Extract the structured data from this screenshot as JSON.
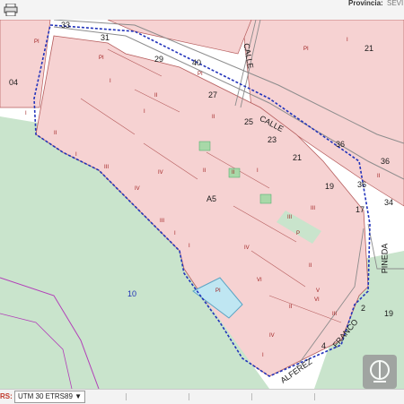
{
  "toolbar": {
    "province_label": "Provincia:",
    "province_value": "SEVI"
  },
  "map": {
    "street_labels": [
      "CALLE",
      "CALLE",
      "PINEDA",
      "FRANCO",
      "ALFEREZ"
    ],
    "house_numbers": [
      "33",
      "31",
      "29",
      "40",
      "27",
      "25",
      "23",
      "21",
      "19",
      "17",
      "36",
      "36",
      "36",
      "34",
      "2",
      "4",
      "19",
      "21",
      "04"
    ],
    "parcel_labels": [
      "A5",
      "10"
    ],
    "lot_codes": [
      "PI",
      "PI",
      "PI",
      "II",
      "II",
      "II",
      "II",
      "IV",
      "IV",
      "VI",
      "III",
      "II",
      "V",
      "IV",
      "I",
      "I",
      "PI",
      "III",
      "I",
      "II",
      "III",
      "II",
      "I",
      "I",
      "I",
      "I",
      "III",
      "II",
      "PI",
      "I",
      "P",
      "IV",
      "III",
      "VI",
      "I"
    ],
    "colors": {
      "building_fill": "#f6d2d2",
      "building_stroke": "#b55c5c",
      "green_area": "#c9e4cc",
      "water": "#bfe6f2",
      "boundary": "#2233bb",
      "river_line": "#b23fb8",
      "road_casing": "#8c8c8c"
    },
    "icons": {
      "printer": "printer-icon",
      "logo": "cadastre-logo-icon"
    }
  },
  "status": {
    "srs_label": "RS:",
    "srs_value": "UTM 30 ETRS89 ▼"
  }
}
